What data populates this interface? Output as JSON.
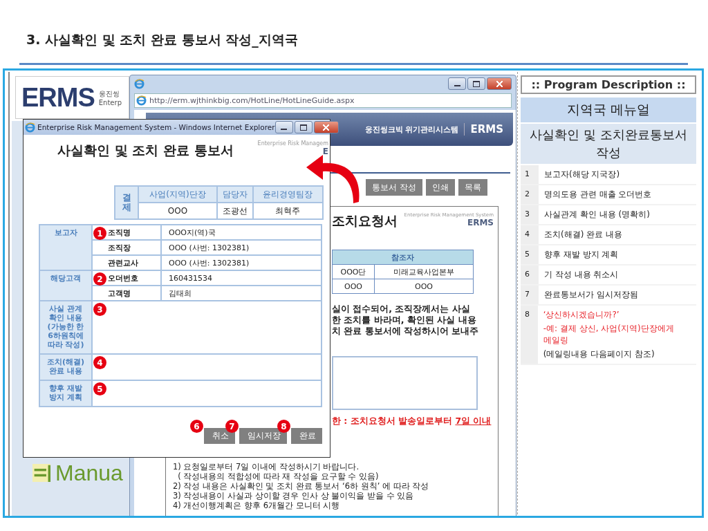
{
  "heading": "3. 사실확인 및 조치 완료 통보서 작성_지역국",
  "background_app": {
    "logo": "ERMS",
    "logo_sub": [
      "웅진씽",
      "Enterp"
    ],
    "manual_label": "Manua"
  },
  "browser": {
    "url": "http://erm.wjthinkbig.com/HotLine/HotLineGuide.aspx",
    "brand": "웅진씽크빅 위기관리시스템",
    "brand_logo": "ERMS",
    "actions": [
      "통보서 작성",
      "인쇄",
      "목록"
    ],
    "document": {
      "title": "조치요청서",
      "brand_small": "Enterprise Risk Management System",
      "brand_logo": "ERMS",
      "table": {
        "header": "참조자",
        "rows": [
          [
            "OOO단",
            "미래교육사업본부"
          ],
          [
            "OOO",
            "OOO"
          ]
        ]
      },
      "notice_lines": [
        "실이 접수되어,  조직장께서는 사실",
        "한 조치를 바라며, 확인된 사실 내용",
        "치 완료 통보서에 작성하시어 보내주"
      ],
      "deadline": {
        "text": "한 : 조치요청서 발송일로부터 ",
        "emphasis": "7일 이내"
      },
      "guide_lines": [
        "1) 요청일로부터 7일 이내에 작성하시기 바랍니다.",
        "  ( 작성내용의 적합성에 따라 재 작성을 요구할 수 있음)",
        "2) 작성 내용은 사실확인 및 조치 완료 통보서 ‘6하 원칙’ 에 따라 작성",
        "3) 작성내용이 사실과 상이할 경우 인사 상 불이익을 받을 수 있음",
        "4) 개선이행계획은 향후 6개월간 모니터 시행"
      ]
    }
  },
  "popup": {
    "window_title": "Enterprise Risk Management System - Windows Internet Explorer",
    "title": "사실확인 및 조치 완료 통보서",
    "brand_small": "Enterprise Risk Managem",
    "brand_logo": "E",
    "approval": {
      "label": "결제",
      "columns": [
        "사업(지역)단장",
        "담당자",
        "윤리경영팀장"
      ],
      "values": [
        "OOO",
        "조광선",
        "최혁주"
      ]
    },
    "sections": [
      {
        "label": "보고자",
        "rows": [
          {
            "label": "조직명",
            "value": "OOO지(역)국",
            "marker": "1"
          },
          {
            "label": "조직장",
            "value": "OOO (사번: 1302381)"
          },
          {
            "label": "관련교사",
            "value": "OOO (사번: 1302381)"
          }
        ]
      },
      {
        "label": "해당고객",
        "rows": [
          {
            "label": "오더번호",
            "value": "160431534",
            "marker": "2"
          },
          {
            "label": "고객명",
            "value": "김태희"
          }
        ]
      },
      {
        "label": "사실 관계 확인 내용 (가능한 한 6하원칙에 따라 작성)",
        "marker": "3"
      },
      {
        "label": "조치(해결) 완료 내용",
        "marker": "4"
      },
      {
        "label": "향후 재발 방지 계획",
        "marker": "5"
      }
    ],
    "buttons": [
      {
        "label": "취소",
        "marker": "6"
      },
      {
        "label": "임시저장",
        "marker": "7"
      },
      {
        "label": "완료",
        "marker": "8"
      }
    ]
  },
  "description": {
    "header": ":: Program Description ::",
    "menu_title": "지역국 메뉴얼",
    "subtitle": "사실확인 및 조치완료통보서 작성",
    "items": [
      {
        "number": "1",
        "lines": [
          {
            "text": "보고자(해당 지국장)",
            "kind": "normal"
          }
        ]
      },
      {
        "number": "2",
        "lines": [
          {
            "text": "명의도용 관련 매출 오더번호",
            "kind": "normal"
          }
        ]
      },
      {
        "number": "3",
        "lines": [
          {
            "text": "사실관계 확인 내용 (명확히)",
            "kind": "normal"
          }
        ]
      },
      {
        "number": "4",
        "lines": [
          {
            "text": "조치(해결) 완료 내용",
            "kind": "normal"
          }
        ]
      },
      {
        "number": "5",
        "lines": [
          {
            "text": "향후 재발 방지 계획",
            "kind": "normal"
          }
        ]
      },
      {
        "number": "6",
        "lines": [
          {
            "text": "기 작성 내용 취소시",
            "kind": "normal"
          }
        ]
      },
      {
        "number": "7",
        "lines": [
          {
            "text": "완료통보서가 임시저장됨",
            "kind": "normal"
          }
        ]
      },
      {
        "number": "8",
        "lines": [
          {
            "text": "‘상신하시겠습니까?’",
            "kind": "alert"
          },
          {
            "text": "-예: 결제 상신, 사업(지역)단장에게 메일링",
            "kind": "alert"
          },
          {
            "text": "(메일링내용 다음페이지 참조)",
            "kind": "normal"
          }
        ]
      }
    ]
  }
}
